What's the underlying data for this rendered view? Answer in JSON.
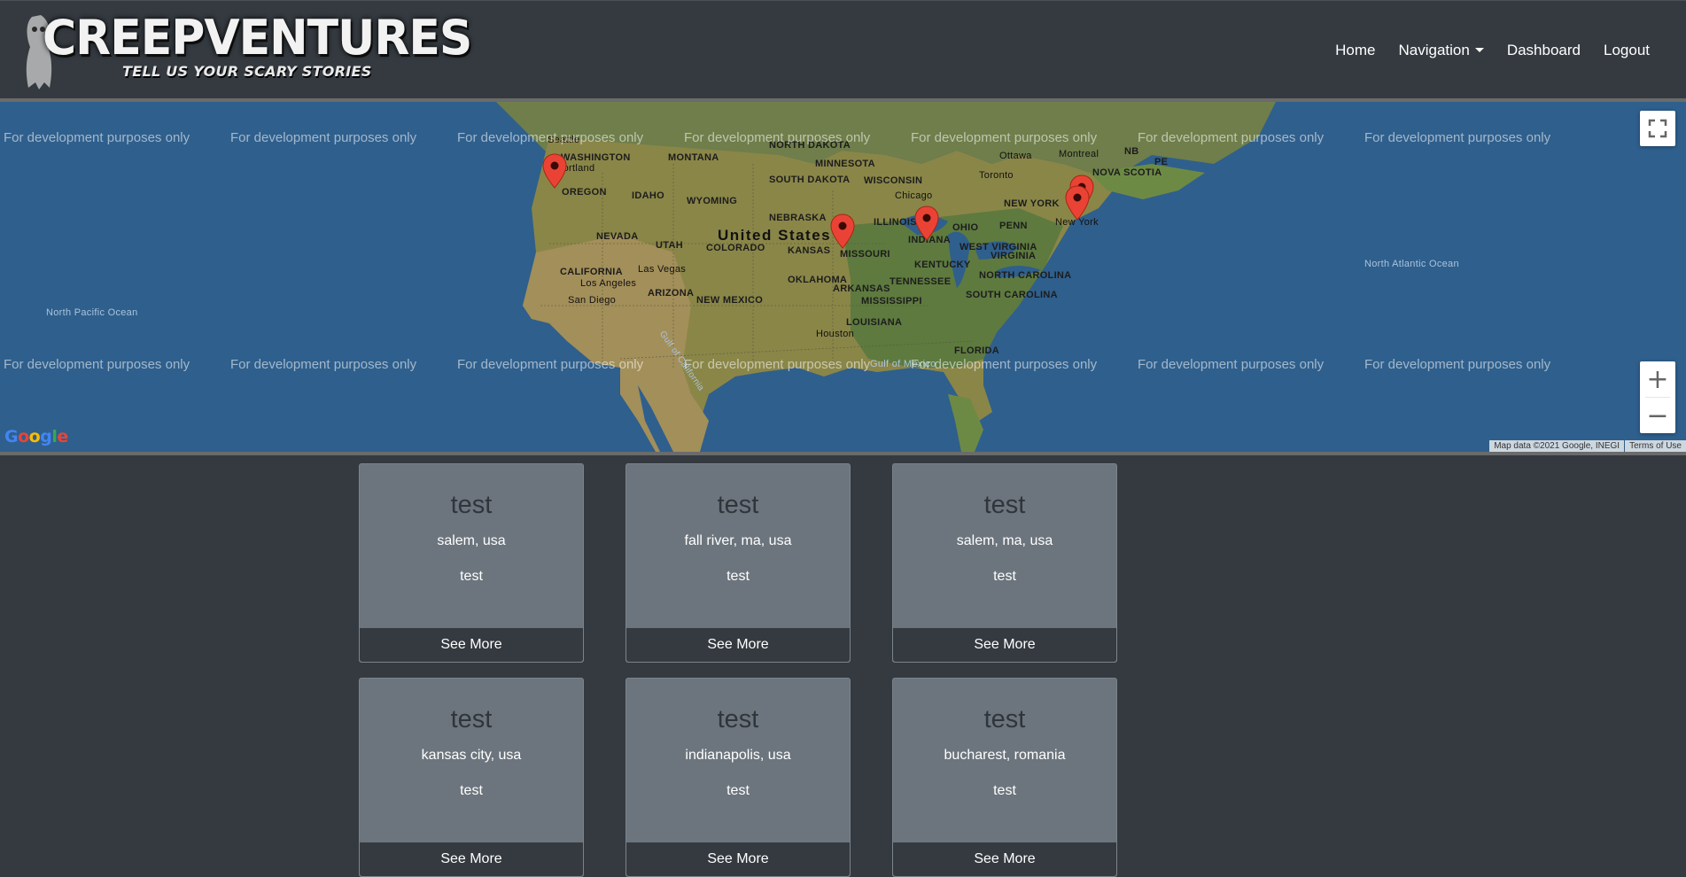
{
  "navbar": {
    "brand_title": "CREEPVENTURES",
    "brand_tagline": "TELL US YOUR SCARY STORIES",
    "links": {
      "home": "Home",
      "navigation": "Navigation",
      "dashboard": "Dashboard",
      "logout": "Logout"
    }
  },
  "map": {
    "watermark": "For development purposes only",
    "google_logo": "Google",
    "attribution": "Map data ©2021 Google, INEGI",
    "terms": "Terms of Use",
    "zoom_in": "+",
    "zoom_out": "−",
    "labels": {
      "united_states": "United States",
      "washington": "WASHINGTON",
      "oregon": "OREGON",
      "montana": "MONTANA",
      "north_dakota": "NORTH DAKOTA",
      "south_dakota": "SOUTH DAKOTA",
      "minnesota": "MINNESOTA",
      "wisconsin": "WISCONSIN",
      "idaho": "IDAHO",
      "wyoming": "WYOMING",
      "nebraska": "NEBRASKA",
      "nevada": "NEVADA",
      "utah": "UTAH",
      "colorado": "COLORADO",
      "kansas": "KANSAS",
      "missouri": "MISSOURI",
      "illinois": "ILLINOIS",
      "indiana": "INDIANA",
      "ohio": "OHIO",
      "kentucky": "KENTUCKY",
      "west_virginia": "WEST VIRGINIA",
      "virginia": "VIRGINIA",
      "tennessee": "TENNESSEE",
      "north_carolina": "NORTH CAROLINA",
      "south_carolina": "SOUTH CAROLINA",
      "arkansas": "ARKANSAS",
      "mississippi": "MISSISSIPPI",
      "louisiana": "LOUISIANA",
      "florida": "FLORIDA",
      "oklahoma": "OKLAHOMA",
      "new_mexico": "NEW MEXICO",
      "arizona": "ARIZONA",
      "california": "CALIFORNIA",
      "new_york": "NEW YORK",
      "penn": "PENN",
      "nova_scotia": "NOVA SCOTIA",
      "nb": "NB",
      "pe": "PE",
      "seattle": "Seattle",
      "portland": "Portland",
      "las_vegas": "Las Vegas",
      "los_angeles": "Los Angeles",
      "san_diego": "San Diego",
      "houston": "Houston",
      "chicago": "Chicago",
      "toronto": "Toronto",
      "ottawa": "Ottawa",
      "montreal": "Montreal",
      "new_york_city": "New York",
      "gulf_of_mexico": "Gulf of Mexico",
      "north_atlantic": "North Atlantic Ocean",
      "north_pacific": "North Pacific Ocean",
      "gulf_of_california": "Gulf of California"
    }
  },
  "cards": [
    {
      "title": "test",
      "location": "salem, usa",
      "description": "test",
      "button": "See More"
    },
    {
      "title": "test",
      "location": "fall river, ma, usa",
      "description": "test",
      "button": "See More"
    },
    {
      "title": "test",
      "location": "salem, ma, usa",
      "description": "test",
      "button": "See More"
    },
    {
      "title": "test",
      "location": "kansas city, usa",
      "description": "test",
      "button": "See More"
    },
    {
      "title": "test",
      "location": "indianapolis, usa",
      "description": "test",
      "button": "See More"
    },
    {
      "title": "test",
      "location": "bucharest, romania",
      "description": "test",
      "button": "See More"
    }
  ],
  "colors": {
    "background": "#343a40",
    "card": "#6c757d",
    "pin": "#ea4335"
  }
}
